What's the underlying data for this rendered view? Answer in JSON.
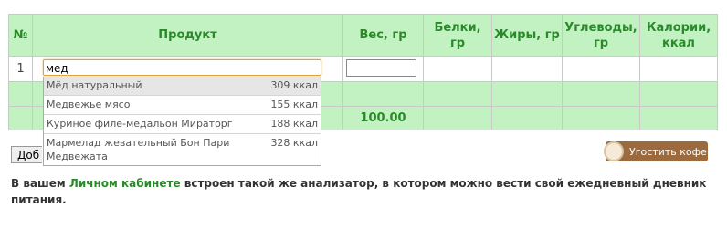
{
  "table": {
    "headers": {
      "num": "№",
      "product": "Продукт",
      "weight": "Вес, гр",
      "protein_line1": "Белки,",
      "protein_line2": "гр",
      "fat": "Жиры, гр",
      "carbs_line1": "Углеводы,",
      "carbs_line2": "гр",
      "calories_line1": "Калории,",
      "calories_line2": "ккал"
    },
    "row1": {
      "num": "1",
      "product_value": "мед",
      "weight_value": ""
    },
    "total_weight": "100.00"
  },
  "autocomplete": [
    {
      "name": "Мёд натуральный",
      "kcal": "309 ккал"
    },
    {
      "name": "Медвежье мясо",
      "kcal": "155 ккал"
    },
    {
      "name": "Куриное филе-медальон Мираторг",
      "kcal": "188 ккал"
    },
    {
      "name": "Мармелад жевательный Бон Пари Медвежата",
      "kcal": "328 ккал"
    }
  ],
  "add_button": "Доб",
  "coffee_button": "Угостить кофе",
  "info": {
    "prefix": "В вашем ",
    "link": "Личном кабинете",
    "suffix": " встроен такой же анализатор, в котором можно вести свой ежедневный дневник питания."
  }
}
